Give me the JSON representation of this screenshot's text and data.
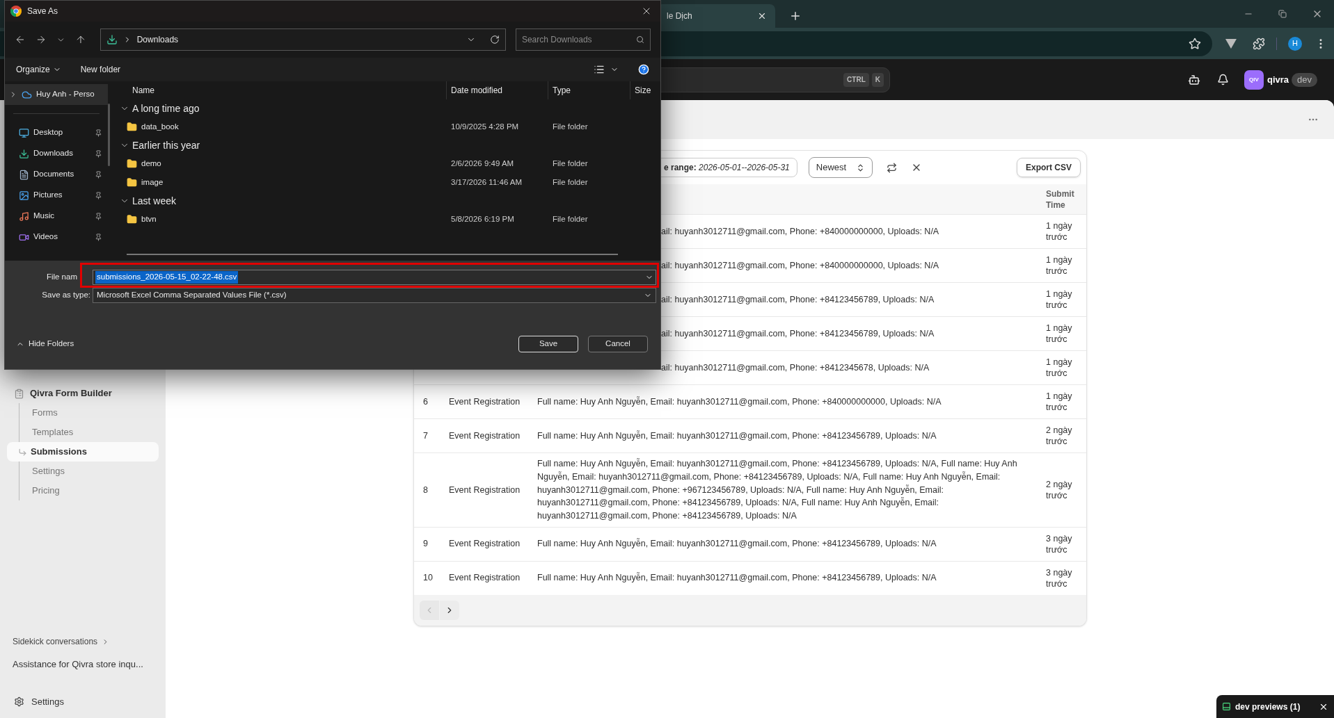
{
  "browser": {
    "tab_title": "le Dịch",
    "profile_initial": "H"
  },
  "app_header": {
    "shortcut_keys": [
      "CTRL",
      "K"
    ],
    "store_badge": "QIV",
    "store_name": "qivra",
    "env_badge": "dev"
  },
  "sidebar": {
    "app": {
      "label": "Qivra Form Builder",
      "children": [
        {
          "label": "Forms",
          "selected": false
        },
        {
          "label": "Templates",
          "selected": false
        },
        {
          "label": "Submissions",
          "selected": true
        },
        {
          "label": "Settings",
          "selected": false
        },
        {
          "label": "Pricing",
          "selected": false
        }
      ]
    },
    "sidekick_link": "Sidekick conversations",
    "conversations": [
      "Assistance for Qivra store inqu..."
    ],
    "settings": "Settings"
  },
  "toolbar": {
    "date_filter_label": "e range:",
    "date_filter_value": "2026-05-01--2026-05-31",
    "sort": "Newest",
    "export": "Export CSV"
  },
  "table": {
    "columns": [
      "Submit Time"
    ],
    "rows": [
      {
        "kind": "partial",
        "details": "ail: huyanh3012711@gmail.com, Phone: +840000000000, Uploads: N/A",
        "submit_time": "1 ngày trước"
      },
      {
        "kind": "partial",
        "details": "ail: huyanh3012711@gmail.com, Phone: +840000000000, Uploads: N/A",
        "submit_time": "1 ngày trước"
      },
      {
        "kind": "partial",
        "details": "ail: huyanh3012711@gmail.com, Phone: +84123456789, Uploads: N/A",
        "submit_time": "1 ngày trước"
      },
      {
        "kind": "partial",
        "details": "ail: huyanh3012711@gmail.com, Phone: +84123456789, Uploads: N/A",
        "submit_time": "1 ngày trước"
      },
      {
        "kind": "partial",
        "details": "ail: huyanh3012711@gmail.com, Phone: +8412345678, Uploads: N/A",
        "submit_time": "1 ngày trước"
      },
      {
        "kind": "full",
        "number": "6",
        "form": "Event Registration",
        "details": "Full name: Huy Anh Nguyễn, Email: huyanh3012711@gmail.com, Phone: +840000000000, Uploads: N/A",
        "submit_time": "1 ngày trước"
      },
      {
        "kind": "full",
        "number": "7",
        "form": "Event Registration",
        "details": "Full name: Huy Anh Nguyễn, Email: huyanh3012711@gmail.com, Phone: +84123456789, Uploads: N/A",
        "submit_time": "2 ngày trước"
      },
      {
        "kind": "full",
        "number": "8",
        "form": "Event Registration",
        "details": "Full name: Huy Anh Nguyễn, Email: huyanh3012711@gmail.com, Phone: +84123456789, Uploads: N/A, Full name: Huy Anh Nguyễn, Email: huyanh3012711@gmail.com, Phone: +84123456789, Uploads: N/A, Full name: Huy Anh Nguyễn, Email: huyanh3012711@gmail.com, Phone: +967123456789, Uploads: N/A, Full name: Huy Anh Nguyễn, Email: huyanh3012711@gmail.com, Phone: +84123456789, Uploads: N/A, Full name: Huy Anh Nguyễn, Email: huyanh3012711@gmail.com, Phone: +84123456789, Uploads: N/A",
        "submit_time": "2 ngày trước"
      },
      {
        "kind": "full",
        "number": "9",
        "form": "Event Registration",
        "details": "Full name: Huy Anh Nguyễn, Email: huyanh3012711@gmail.com, Phone: +84123456789, Uploads: N/A",
        "submit_time": "3 ngày trước"
      },
      {
        "kind": "full",
        "number": "10",
        "form": "Event Registration",
        "details": "Full name: Huy Anh Nguyễn, Email: huyanh3012711@gmail.com, Phone: +84123456789, Uploads: N/A",
        "submit_time": "3 ngày trước"
      }
    ]
  },
  "pagination": {
    "previous_disabled": true
  },
  "dev_previews": "dev previews (1)",
  "dialog": {
    "title": "Save As",
    "path": "Downloads",
    "search_placeholder": "Search Downloads",
    "organize": "Organize",
    "new_folder": "New folder",
    "nav": [
      {
        "label": "Huy Anh - Perso",
        "kind": "cloud",
        "selected": true,
        "pinned": false
      },
      {
        "label": "Desktop",
        "kind": "desktop",
        "selected": false,
        "pinned": true
      },
      {
        "label": "Downloads",
        "kind": "downloads",
        "selected": false,
        "pinned": true
      },
      {
        "label": "Documents",
        "kind": "documents",
        "selected": false,
        "pinned": true
      },
      {
        "label": "Pictures",
        "kind": "pictures",
        "selected": false,
        "pinned": true
      },
      {
        "label": "Music",
        "kind": "music",
        "selected": false,
        "pinned": true
      },
      {
        "label": "Videos",
        "kind": "videos",
        "selected": false,
        "pinned": true
      }
    ],
    "columns": [
      "Name",
      "Date modified",
      "Type",
      "Size"
    ],
    "groups": [
      {
        "label": "A long time ago",
        "expanded": true,
        "items": [
          {
            "name": "data_book",
            "date": "10/9/2025 4:28 PM",
            "type": "File folder"
          }
        ]
      },
      {
        "label": "Earlier this year",
        "expanded": true,
        "items": [
          {
            "name": "demo",
            "date": "2/6/2026 9:49 AM",
            "type": "File folder"
          },
          {
            "name": "image",
            "date": "3/17/2026 11:46 AM",
            "type": "File folder"
          }
        ]
      },
      {
        "label": "Last week",
        "expanded": true,
        "items": [
          {
            "name": "btvn",
            "date": "5/8/2026 6:19 PM",
            "type": "File folder"
          }
        ]
      }
    ],
    "file_name_label": "File nam",
    "file_name": "submissions_2026-05-15_02-22-48.csv",
    "file_name_selected": true,
    "save_type_label": "Save as type:",
    "save_type": "Microsoft Excel Comma Separated Values File (*.csv)",
    "hide_folders": "Hide Folders",
    "buttons": [
      "Save",
      "Cancel"
    ]
  }
}
